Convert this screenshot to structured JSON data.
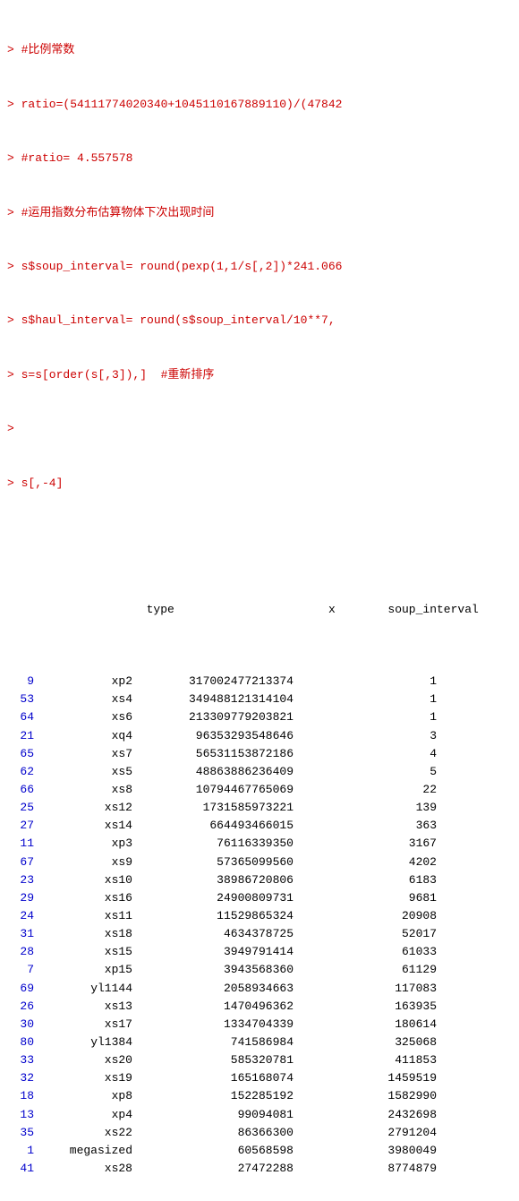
{
  "console": {
    "prompt_symbol": ">",
    "lines": [
      {
        "type": "comment",
        "text": "> #比例常数"
      },
      {
        "type": "prompt",
        "text": "> ratio=(54111774020340+1045110167889110)/(47842"
      },
      {
        "type": "comment",
        "text": "> #ratio= 4.557578"
      },
      {
        "type": "comment",
        "text": "> #运用指数分布估算物体下次出现时间"
      },
      {
        "type": "prompt",
        "text": "> s$soup_interval= round(pexp(1,1/s[,2])*241.066"
      },
      {
        "type": "prompt",
        "text": "> s$haul_interval= round(s$soup_interval/10**7,"
      },
      {
        "type": "prompt",
        "text": "> s=s[order(s[,3]),]  #重新排序"
      },
      {
        "type": "prompt",
        "text": ">"
      },
      {
        "type": "prompt",
        "text": "> s[,-4]"
      }
    ],
    "table": {
      "headers": [
        "",
        "type",
        "x",
        "soup_interval"
      ],
      "rows": [
        {
          "rownum": "9",
          "type": "xp2",
          "x": "317002477213374",
          "soup_interval": "1"
        },
        {
          "rownum": "53",
          "type": "xs4",
          "x": "349488121314104",
          "soup_interval": "1"
        },
        {
          "rownum": "64",
          "type": "xs6",
          "x": "213309779203821",
          "soup_interval": "1"
        },
        {
          "rownum": "21",
          "type": "xq4",
          "x": "96353293548646",
          "soup_interval": "3"
        },
        {
          "rownum": "65",
          "type": "xs7",
          "x": "56531153872186",
          "soup_interval": "4"
        },
        {
          "rownum": "62",
          "type": "xs5",
          "x": "48863886236409",
          "soup_interval": "5"
        },
        {
          "rownum": "66",
          "type": "xs8",
          "x": "10794467765069",
          "soup_interval": "22"
        },
        {
          "rownum": "25",
          "type": "xs12",
          "x": "1731585973221",
          "soup_interval": "139"
        },
        {
          "rownum": "27",
          "type": "xs14",
          "x": "664493466015",
          "soup_interval": "363"
        },
        {
          "rownum": "11",
          "type": "xp3",
          "x": "76116339350",
          "soup_interval": "3167"
        },
        {
          "rownum": "67",
          "type": "xs9",
          "x": "57365099560",
          "soup_interval": "4202"
        },
        {
          "rownum": "23",
          "type": "xs10",
          "x": "38986720806",
          "soup_interval": "6183"
        },
        {
          "rownum": "29",
          "type": "xs16",
          "x": "24900809731",
          "soup_interval": "9681"
        },
        {
          "rownum": "24",
          "type": "xs11",
          "x": "11529865324",
          "soup_interval": "20908"
        },
        {
          "rownum": "31",
          "type": "xs18",
          "x": "4634378725",
          "soup_interval": "52017"
        },
        {
          "rownum": "28",
          "type": "xs15",
          "x": "3949791414",
          "soup_interval": "61033"
        },
        {
          "rownum": "7",
          "type": "xp15",
          "x": "3943568360",
          "soup_interval": "61129"
        },
        {
          "rownum": "69",
          "type": "yl1144",
          "x": "2058934663",
          "soup_interval": "117083"
        },
        {
          "rownum": "26",
          "type": "xs13",
          "x": "1470496362",
          "soup_interval": "163935"
        },
        {
          "rownum": "30",
          "type": "xs17",
          "x": "1334704339",
          "soup_interval": "180614"
        },
        {
          "rownum": "80",
          "type": "yl1384",
          "x": "741586984",
          "soup_interval": "325068"
        },
        {
          "rownum": "33",
          "type": "xs20",
          "x": "585320781",
          "soup_interval": "411853"
        },
        {
          "rownum": "32",
          "type": "xs19",
          "x": "165168074",
          "soup_interval": "1459519"
        },
        {
          "rownum": "18",
          "type": "xp8",
          "x": "152285192",
          "soup_interval": "1582990"
        },
        {
          "rownum": "13",
          "type": "xp4",
          "x": "99094081",
          "soup_interval": "2432698"
        },
        {
          "rownum": "35",
          "type": "xs22",
          "x": "86366300",
          "soup_interval": "2791204"
        },
        {
          "rownum": "1",
          "type": "megasized",
          "x": "60568598",
          "soup_interval": "3980049"
        },
        {
          "rownum": "41",
          "type": "xs28",
          "x": "27472288",
          "soup_interval": "8774879"
        }
      ]
    }
  }
}
